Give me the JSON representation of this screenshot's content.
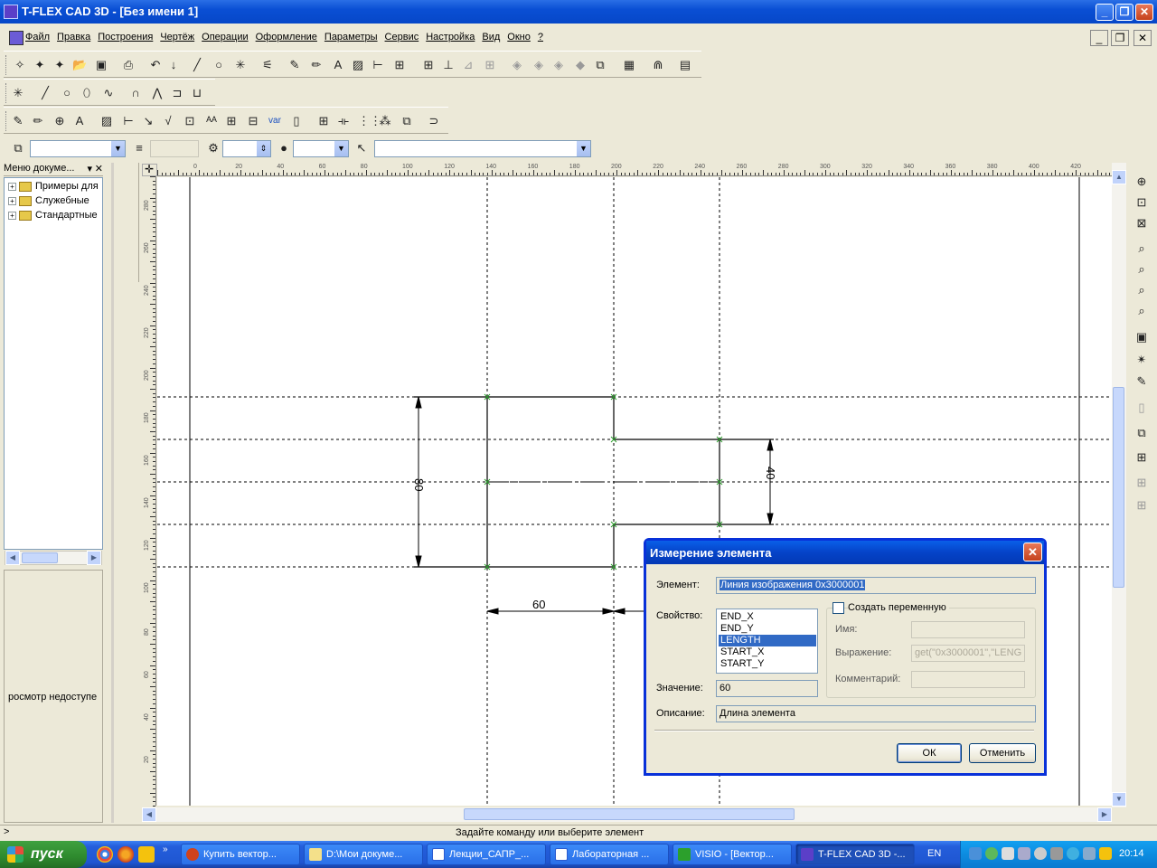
{
  "window": {
    "title": "T-FLEX CAD 3D - [Без имени 1]"
  },
  "menu": {
    "items": [
      "Файл",
      "Правка",
      "Построения",
      "Чертёж",
      "Операции",
      "Оформление",
      "Параметры",
      "Сервис",
      "Настройка",
      "Вид",
      "Окно",
      "?"
    ]
  },
  "left_panel": {
    "header": "Меню докуме...",
    "tree": [
      {
        "label": "Примеры для"
      },
      {
        "label": "Служебные"
      },
      {
        "label": "Стандартные"
      }
    ],
    "preview_text": "росмотр недоступе"
  },
  "ruler": {
    "h_ticks": [
      "0",
      "20",
      "40",
      "60",
      "80",
      "100",
      "120",
      "140",
      "160",
      "180",
      "200",
      "220",
      "240",
      "260",
      "280",
      "300",
      "320",
      "340",
      "360",
      "380",
      "400",
      "420"
    ],
    "v_ticks": [
      "280",
      "260",
      "240",
      "220",
      "200",
      "180",
      "160",
      "140",
      "120",
      "100",
      "80",
      "60",
      "40",
      "20"
    ]
  },
  "drawing": {
    "dim_width": "60",
    "dim_height_left": "80",
    "dim_height_right": "40"
  },
  "dialog": {
    "title": "Измерение элемента",
    "element_label": "Элемент:",
    "element_value": "Линия изображения 0x3000001",
    "property_label": "Свойство:",
    "properties": [
      "END_X",
      "END_Y",
      "LENGTH",
      "START_X",
      "START_Y"
    ],
    "selected_property": "LENGTH",
    "value_label": "Значение:",
    "value": "60",
    "description_label": "Описание:",
    "description": "Длина элемента",
    "create_var_label": "Создать переменную",
    "create_var_checked": false,
    "name_label": "Имя:",
    "name_value": "",
    "expression_label": "Выражение:",
    "expression_value": "get(\"0x3000001\",\"LENG",
    "comment_label": "Комментарий:",
    "comment_value": "",
    "ok": "ОК",
    "cancel": "Отменить"
  },
  "status": {
    "prompt": ">",
    "message": "Задайте команду или выберите элемент"
  },
  "taskbar": {
    "start": "пуск",
    "tasks": [
      {
        "label": "Купить вектор...",
        "active": false
      },
      {
        "label": "D:\\Мои докуме...",
        "active": false
      },
      {
        "label": "Лекции_САПР_...",
        "active": false
      },
      {
        "label": "Лабораторная ...",
        "active": false
      },
      {
        "label": "VISIO - [Вектор...",
        "active": false
      },
      {
        "label": "T-FLEX CAD 3D -...",
        "active": true
      }
    ],
    "language": "EN",
    "clock": "20:14"
  },
  "colors": {
    "titlebar": "#0a4fd4",
    "selection": "#316ac5",
    "taskbar": "#245edb",
    "start": "#2e8a2e"
  }
}
